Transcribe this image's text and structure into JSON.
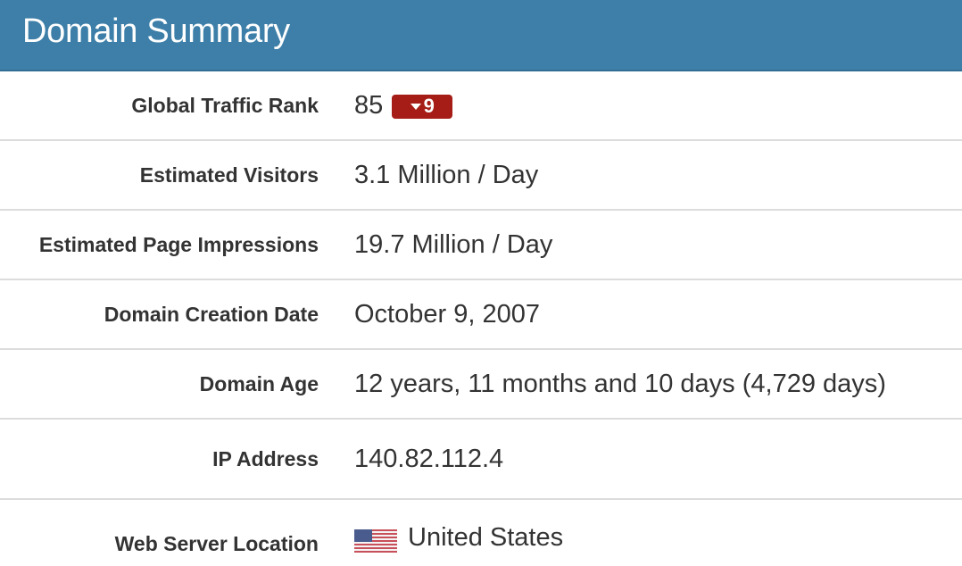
{
  "header": {
    "title": "Domain Summary"
  },
  "colors": {
    "header_bg": "#3d7fa8",
    "badge_bg": "#a51d16",
    "divider": "#dcdcdc"
  },
  "rows": [
    {
      "label": "Global Traffic Rank",
      "value": "85",
      "badge": {
        "icon": "caret-down-icon",
        "text": "9"
      }
    },
    {
      "label": "Estimated Visitors",
      "value": "3.1 Million / Day"
    },
    {
      "label": "Estimated Page Impressions",
      "value": "19.7 Million / Day"
    },
    {
      "label": "Domain Creation Date",
      "value": "October 9, 2007"
    },
    {
      "label": "Domain Age",
      "value": "12 years, 11 months and 10 days (4,729 days)"
    },
    {
      "label": "IP Address",
      "value": "140.82.112.4"
    },
    {
      "label": "Web Server Location",
      "value": "United States",
      "icon": "us-flag-icon"
    }
  ]
}
